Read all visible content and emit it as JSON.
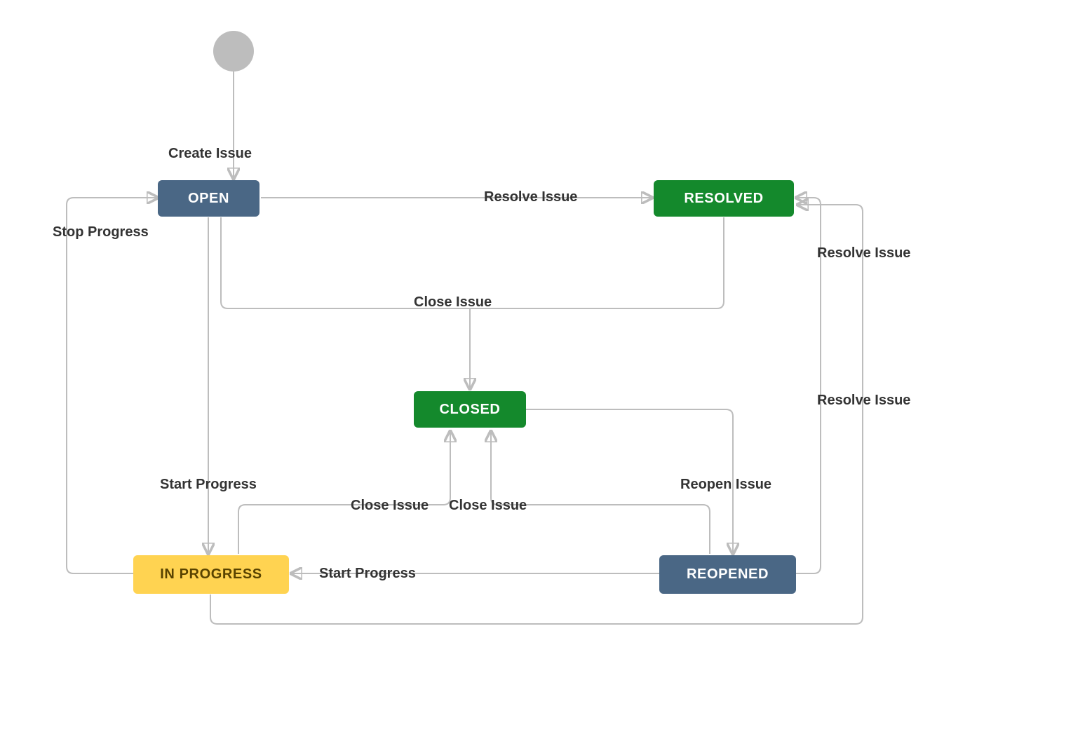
{
  "diagram": {
    "type": "state-machine",
    "start_node": true,
    "states": {
      "open": {
        "label": "OPEN",
        "color": "blue"
      },
      "resolved": {
        "label": "RESOLVED",
        "color": "green"
      },
      "closed": {
        "label": "CLOSED",
        "color": "green"
      },
      "in_progress": {
        "label": "IN PROGRESS",
        "color": "yellow"
      },
      "reopened": {
        "label": "REOPENED",
        "color": "blue"
      }
    },
    "transitions": {
      "create_issue": {
        "label": "Create Issue",
        "from": "start",
        "to": "open"
      },
      "resolve_issue": {
        "label": "Resolve Issue",
        "from": "open",
        "to": "resolved"
      },
      "close_issue": {
        "label": "Close Issue",
        "from": "open",
        "to": "closed"
      },
      "close_issue_resolved": {
        "label": "Close Issue",
        "from": "resolved",
        "to": "closed"
      },
      "start_progress_open": {
        "label": "Start Progress",
        "from": "open",
        "to": "in_progress"
      },
      "stop_progress": {
        "label": "Stop Progress",
        "from": "in_progress",
        "to": "open"
      },
      "close_issue_inprogress": {
        "label": "Close Issue",
        "from": "in_progress",
        "to": "closed"
      },
      "resolve_issue_inprogress": {
        "label": "Resolve Issue",
        "from": "in_progress",
        "to": "resolved"
      },
      "reopen_issue": {
        "label": "Reopen Issue",
        "from": "closed",
        "to": "reopened"
      },
      "start_progress_reopened": {
        "label": "Start Progress",
        "from": "reopened",
        "to": "in_progress"
      },
      "close_issue_reopened": {
        "label": "Close Issue",
        "from": "reopened",
        "to": "closed"
      },
      "resolve_issue_reopened": {
        "label": "Resolve Issue",
        "from": "reopened",
        "to": "resolved"
      }
    }
  },
  "colors": {
    "blue": "#4a6785",
    "green": "#14892c",
    "yellow": "#ffd351",
    "edge": "#bdbdbd",
    "text": "#333333"
  }
}
